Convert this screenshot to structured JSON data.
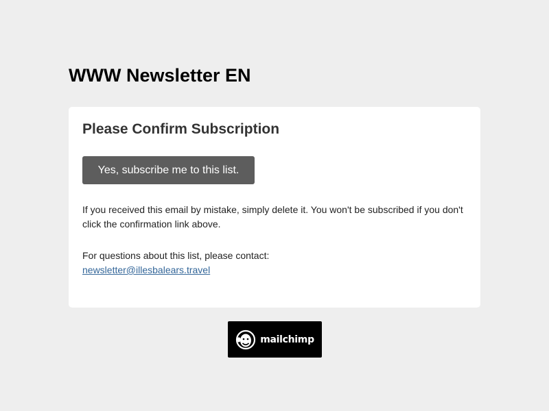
{
  "list": {
    "title": "WWW Newsletter EN"
  },
  "confirm": {
    "heading": "Please Confirm Subscription",
    "button_label": "Yes, subscribe me to this list.",
    "note": "If you received this email by mistake, simply delete it. You won't be subscribed if you don't click the confirmation link above.",
    "contact_text": "For questions about this list, please contact:",
    "contact_email": "newsletter@illesbalears.travel"
  },
  "footer": {
    "badge_text": "mailchimp",
    "badge_icon": "mailchimp-freddie-icon"
  },
  "colors": {
    "background": "#eeeeee",
    "card": "#ffffff",
    "button": "#5d5d5d",
    "link": "#336699"
  }
}
